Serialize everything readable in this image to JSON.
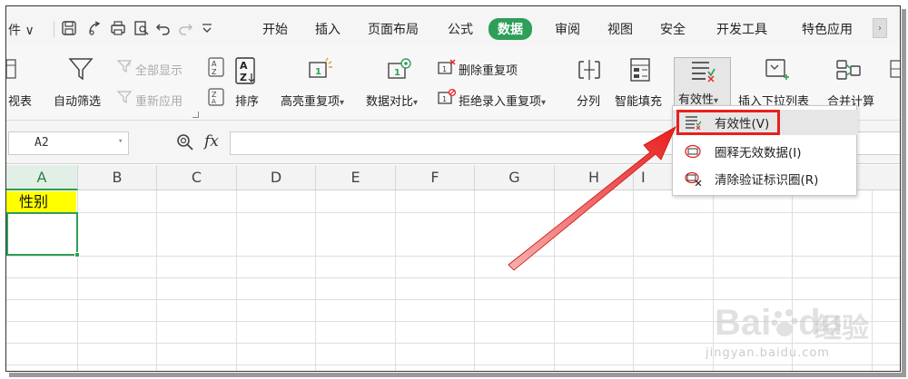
{
  "menubar": {
    "file_label": "件 ∨",
    "tabs": [
      "开始",
      "插入",
      "页面布局",
      "公式",
      "数据",
      "审阅",
      "视图",
      "安全",
      "开发工具",
      "特色应用"
    ],
    "active_tab": "数据",
    "scroll_glyph": "›"
  },
  "ribbon": {
    "pivot_partial": "视表",
    "auto_filter": "自动筛选",
    "show_all": "全部显示",
    "reapply": "重新应用",
    "sort": "排序",
    "highlight_dup": "高亮重复项",
    "data_compare": "数据对比",
    "remove_dup": "删除重复项",
    "reject_dup": "拒绝录入重复项",
    "split_col": "分列",
    "smart_fill": "智能填充",
    "validity": "有效性",
    "insert_dropdown": "插入下拉列表",
    "consolidate": "合并计算",
    "caret": "▾"
  },
  "formula_bar": {
    "name_box": "A2",
    "fx": "fx",
    "caret": "▾"
  },
  "grid": {
    "columns": [
      "A",
      "B",
      "C",
      "D",
      "E",
      "F",
      "G",
      "H",
      "I"
    ],
    "active_column": "A",
    "cell_a1": "性别"
  },
  "dropdown": {
    "items": [
      "有效性(V)",
      "圈释无效数据(I)",
      "清除验证标识圈(R)"
    ]
  },
  "watermark": {
    "brand": "Bai",
    "brand2": "du",
    "cn": "经验",
    "url": "jingyan.baidu.com"
  },
  "colors": {
    "active_tab": "#2e9e58",
    "header_fill": "#ffff00",
    "annotation": "#e8201e"
  }
}
